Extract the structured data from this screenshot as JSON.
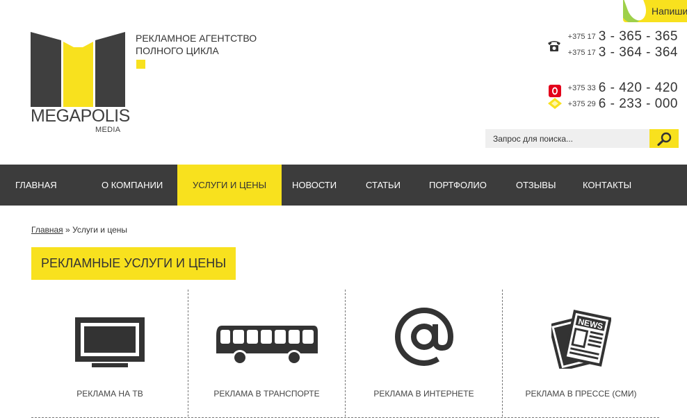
{
  "write_tab": {
    "label": "Напиши"
  },
  "logo": {
    "brand": "MEGAPOLIS",
    "sub": "MEDIA"
  },
  "tagline": {
    "line1": "Рекламное агентство",
    "line2": "полного цикла"
  },
  "phones": [
    {
      "code": "+375 17",
      "number": "3 - 365 - 365",
      "icon": "landline-phone-icon"
    },
    {
      "code": "+375 17",
      "number": "3 - 364 - 364",
      "icon": ""
    },
    {
      "code": "+375 33",
      "number": "6 - 420 - 420",
      "icon": "mts-operator-icon"
    },
    {
      "code": "+375 29",
      "number": "6 - 233 - 000",
      "icon": "velcom-operator-icon"
    }
  ],
  "search": {
    "placeholder": "Запрос для поиска...",
    "icon": "magnifier-icon"
  },
  "nav": {
    "items": [
      {
        "label": "Главная",
        "active": false
      },
      {
        "label": "О компании",
        "active": false
      },
      {
        "label": "Услуги и цены",
        "active": true
      },
      {
        "label": "Новости",
        "active": false
      },
      {
        "label": "Статьи",
        "active": false
      },
      {
        "label": "Портфолио",
        "active": false
      },
      {
        "label": "Отзывы",
        "active": false
      },
      {
        "label": "Контакты",
        "active": false
      }
    ]
  },
  "breadcrumb": {
    "home": "Главная",
    "separator": "»",
    "current": "Услуги и цены"
  },
  "page_title": "Рекламные услуги и цены",
  "services": [
    {
      "label": "Реклама на ТВ",
      "icon": "tv-icon"
    },
    {
      "label": "Реклама в транспорте",
      "icon": "bus-icon"
    },
    {
      "label": "Реклама в интернете",
      "icon": "at-sign-icon"
    },
    {
      "label": "Реклама в прессе (СМИ)",
      "icon": "newspaper-icon",
      "icon_text": "NEWS"
    }
  ],
  "colors": {
    "accent": "#f8e11e",
    "dark": "#3c3c3c",
    "green": "#9ed04a"
  }
}
